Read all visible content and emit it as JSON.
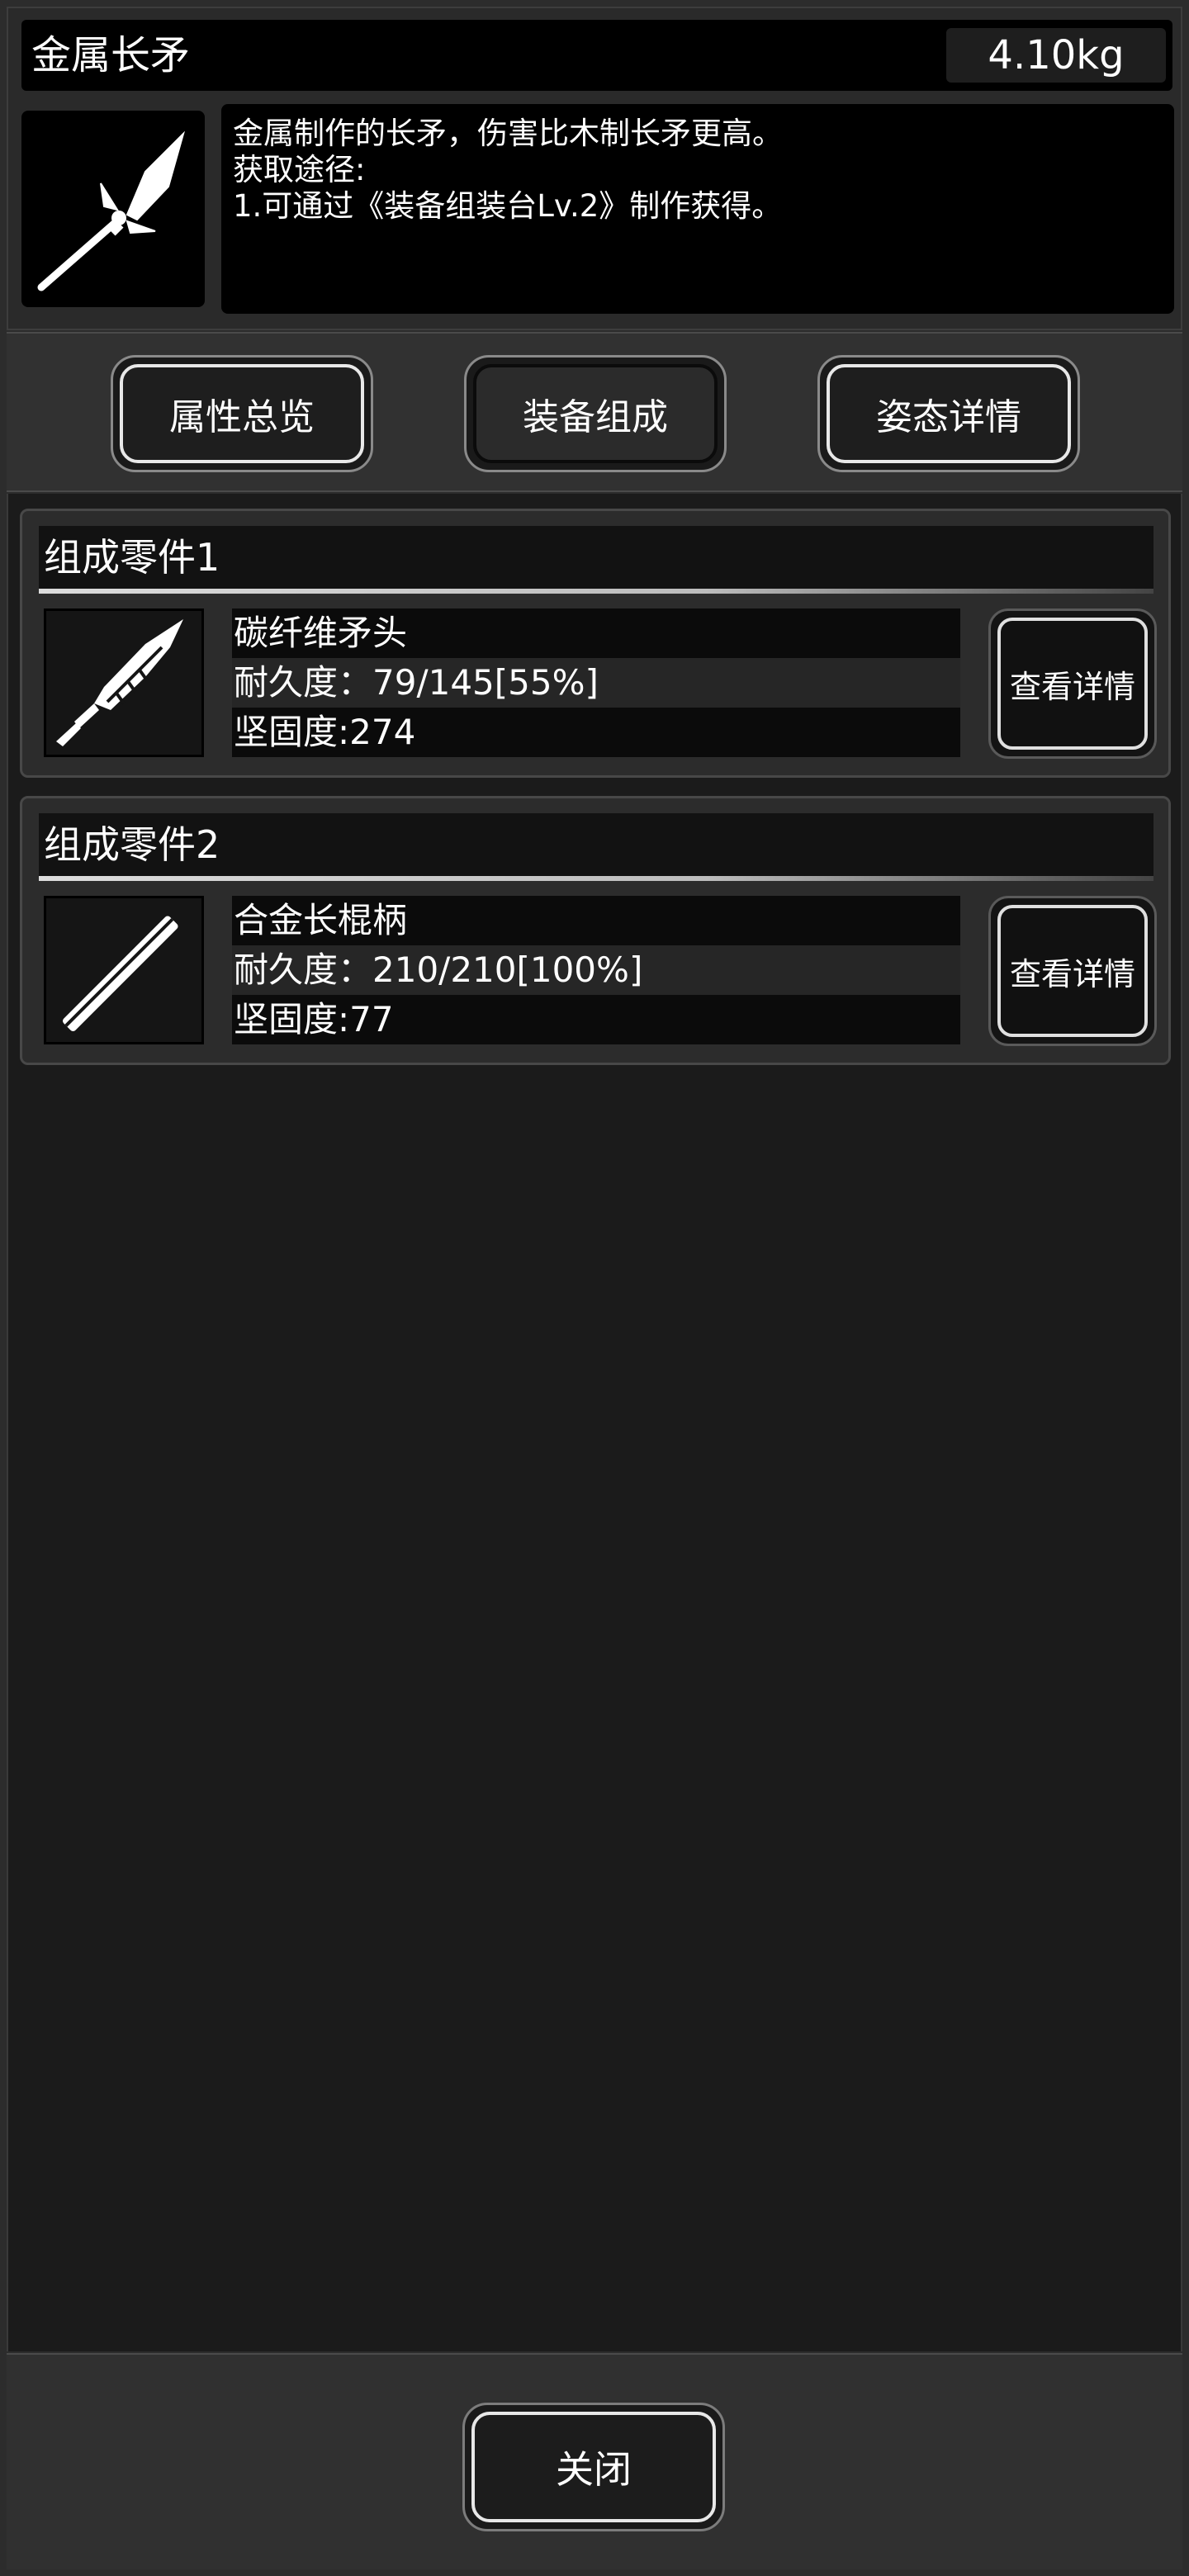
{
  "item": {
    "name": "金属长矛",
    "weight": "4.10kg",
    "icon": "spear-icon",
    "description": [
      "金属制作的长矛，伤害比木制长矛更高。",
      "获取途径:",
      "1.可通过《装备组装台Lv.2》制作获得。"
    ]
  },
  "tabs": [
    {
      "label": "属性总览",
      "active": false
    },
    {
      "label": "装备组成",
      "active": true
    },
    {
      "label": "姿态详情",
      "active": false
    }
  ],
  "parts": [
    {
      "header": "组成零件1",
      "icon": "spearhead-icon",
      "name": "碳纤维矛头",
      "durability": "耐久度：79/145[55%]",
      "firmness": "坚固度:274",
      "detail_label": "查看详情"
    },
    {
      "header": "组成零件2",
      "icon": "pole-icon",
      "name": "合金长棍柄",
      "durability": "耐久度：210/210[100%]",
      "firmness": "坚固度:77",
      "detail_label": "查看详情"
    }
  ],
  "footer": {
    "close_label": "关闭"
  }
}
